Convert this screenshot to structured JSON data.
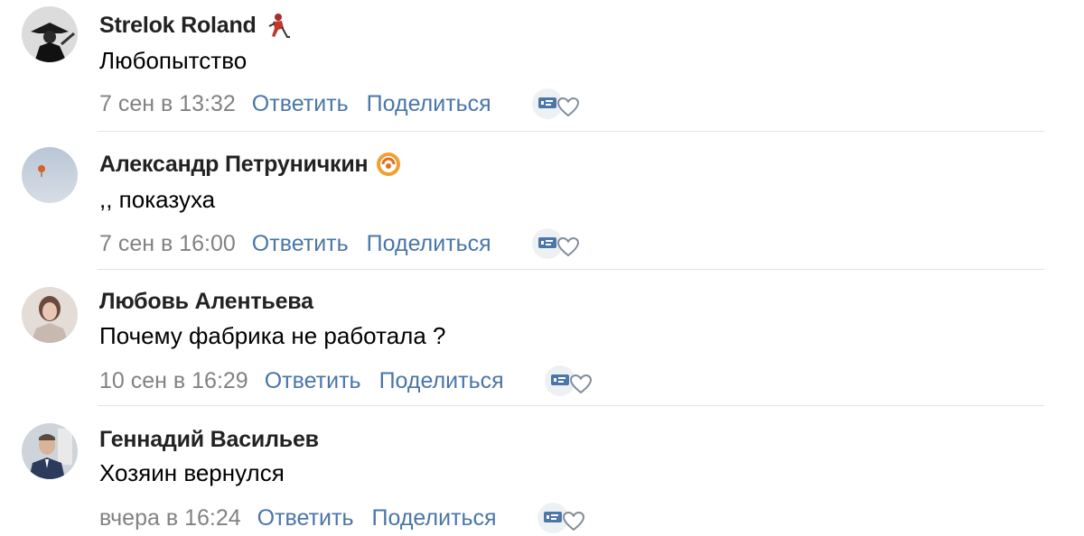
{
  "comments": [
    {
      "author": "Strelok Roland",
      "text": "Любопытство",
      "time": "7 сен в 13:32",
      "reply_label": "Ответить",
      "share_label": "Поделиться",
      "badge_icon": "hockey-player-icon"
    },
    {
      "author": "Александр Петруничкин",
      "text": ",, показуха",
      "time": "7 сен в 16:00",
      "reply_label": "Ответить",
      "share_label": "Поделиться",
      "badge_icon": "orange-emblem-icon"
    },
    {
      "author": "Любовь Алентьева",
      "text": "Почему фабрика не работала ?",
      "time": "10 сен в 16:29",
      "reply_label": "Ответить",
      "share_label": "Поделиться"
    },
    {
      "author": "Геннадий Васильев",
      "text": "Хозяин вернулся",
      "time": "вчера в 16:24",
      "reply_label": "Ответить",
      "share_label": "Поделиться"
    }
  ],
  "colors": {
    "link": "#4a76a8",
    "meta": "#828282",
    "divider": "#e1e3e6",
    "author": "#222222"
  },
  "icons": {
    "reaction": "reaction-icon",
    "like": "heart-icon"
  }
}
